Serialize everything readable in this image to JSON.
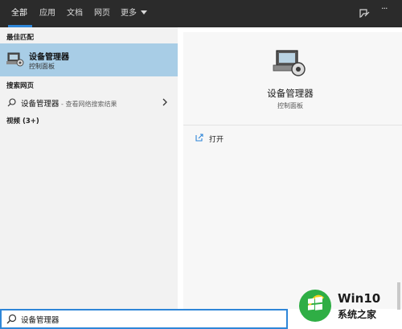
{
  "tabs": [
    {
      "label": "全部",
      "active": true
    },
    {
      "label": "应用"
    },
    {
      "label": "文档"
    },
    {
      "label": "网页"
    },
    {
      "label": "更多"
    }
  ],
  "top_icons": [
    "feedback-icon",
    "more-options-icon"
  ],
  "more_options_glyph": "···",
  "results": {
    "best_match_heading": "最佳匹配",
    "best_match": {
      "title": "设备管理器",
      "subtitle": "控制面板",
      "icon": "device-manager-icon"
    },
    "web_heading": "搜索网页",
    "web_result": {
      "query": "设备管理器",
      "separator": " - ",
      "suffix": "查看网络搜索结果"
    },
    "videos_heading": "视频 (3+)"
  },
  "preview": {
    "title": "设备管理器",
    "subtitle": "控制面板",
    "actions": [
      {
        "label": "打开",
        "icon": "open-icon"
      }
    ]
  },
  "search": {
    "value": "设备管理器",
    "placeholder": ""
  },
  "watermark": {
    "line1": "Win10",
    "line2": "系统之家"
  },
  "colors": {
    "accent": "#2e86d8",
    "selected_bg": "#a8cde6",
    "topbar_bg": "#2b2b2b"
  }
}
